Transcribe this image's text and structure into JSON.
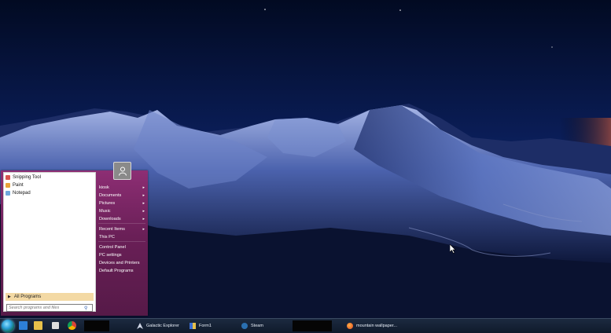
{
  "start_menu": {
    "pinned_programs": [
      {
        "label": "Snipping Tool",
        "icon": "scissors-icon",
        "color": "#d9534f"
      },
      {
        "label": "Paint",
        "icon": "paint-palette-icon",
        "color": "#e8a33a"
      },
      {
        "label": "Notepad",
        "icon": "notepad-icon",
        "color": "#6fa8dc"
      }
    ],
    "all_programs_label": "All Programs",
    "search_placeholder": "Search programs and files",
    "right_pane": {
      "group1": [
        {
          "label": "kiosk",
          "submenu": true
        },
        {
          "label": "Documents",
          "submenu": true
        },
        {
          "label": "Pictures",
          "submenu": true
        },
        {
          "label": "Music",
          "submenu": true
        },
        {
          "label": "Downloads",
          "submenu": true
        }
      ],
      "group2": [
        {
          "label": "Recent Items",
          "submenu": true
        },
        {
          "label": "This PC",
          "submenu": false
        }
      ],
      "group3": [
        {
          "label": "Control Panel",
          "submenu": false
        },
        {
          "label": "PC settings",
          "submenu": false
        },
        {
          "label": "Devices and Printers",
          "submenu": false
        },
        {
          "label": "Default Programs",
          "submenu": false
        }
      ]
    }
  },
  "taskbar": {
    "pinned": [
      {
        "name": "mail-icon",
        "color": "#2d7fd8"
      },
      {
        "name": "file-explorer-icon",
        "color": "#e8c14a"
      },
      {
        "name": "store-icon",
        "color": "#dddddd"
      },
      {
        "name": "chrome-icon",
        "color": "#db4437"
      }
    ],
    "buttons": [
      {
        "label": "Galactic Explorer",
        "icon": "galactic-explorer-icon"
      },
      {
        "label": "Form1",
        "icon": "form-window-icon"
      },
      {
        "label": "Steam",
        "icon": "steam-icon"
      },
      {
        "label": "mountain wallpaper...",
        "icon": "firefox-icon"
      }
    ]
  },
  "colors": {
    "menu_accent": "#7a2565",
    "all_programs_bg": "#f3d9a4",
    "taskbar_bg": "#14213a",
    "sky_top": "#040c25",
    "sky_horizon": "#1c3a8a"
  }
}
